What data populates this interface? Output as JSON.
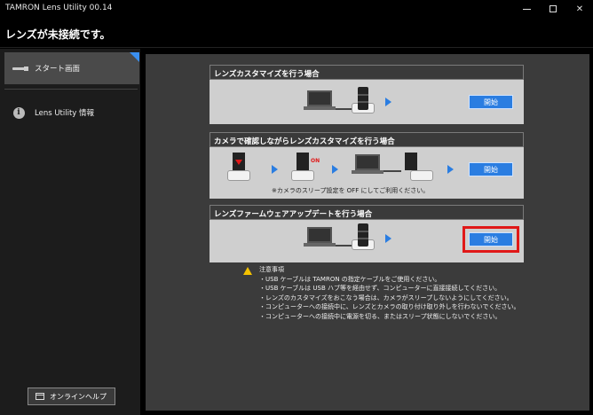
{
  "window": {
    "title": "TAMRON Lens Utility 00.14",
    "min_glyph": "",
    "max_glyph": "",
    "close_glyph": "✕"
  },
  "status": {
    "message": "レンズが未接続です。"
  },
  "sidebar": {
    "items": [
      {
        "label": "スタート画面",
        "icon": "cable-icon",
        "active": true
      },
      {
        "label": "Lens Utility 情報",
        "icon": "info-icon",
        "active": false
      }
    ],
    "help_button": "オンラインヘルプ"
  },
  "panels": [
    {
      "title": "レンズカスタマイズを行う場合",
      "button": "開始"
    },
    {
      "title": "カメラで確認しながらレンズカスタマイズを行う場合",
      "button": "開始",
      "on_label": "ON",
      "note": "※カメラのスリープ設定を OFF にしてご利用ください。"
    },
    {
      "title": "レンズファームウェアアップデートを行う場合",
      "button": "開始"
    }
  ],
  "notice": {
    "heading": "注意事項",
    "lines": [
      "・USB ケーブルは TAMRON の指定ケーブルをご使用ください。",
      "・USB ケーブルは USB ハブ等を経由せず、コンピューターに直接接続してください。",
      "・レンズのカスタマイズをおこなう場合は、カメラがスリープしないようにしてください。",
      "・コンピューターへの接続中に、レンズとカメラの取り付け取り外しを行わないでください。",
      "・コンピューターへの接続中に電源を切る、またはスリープ状態にしないでください。"
    ]
  },
  "colors": {
    "accent": "#2a7de1",
    "highlight": "#e01818",
    "warning": "#f5c200"
  }
}
